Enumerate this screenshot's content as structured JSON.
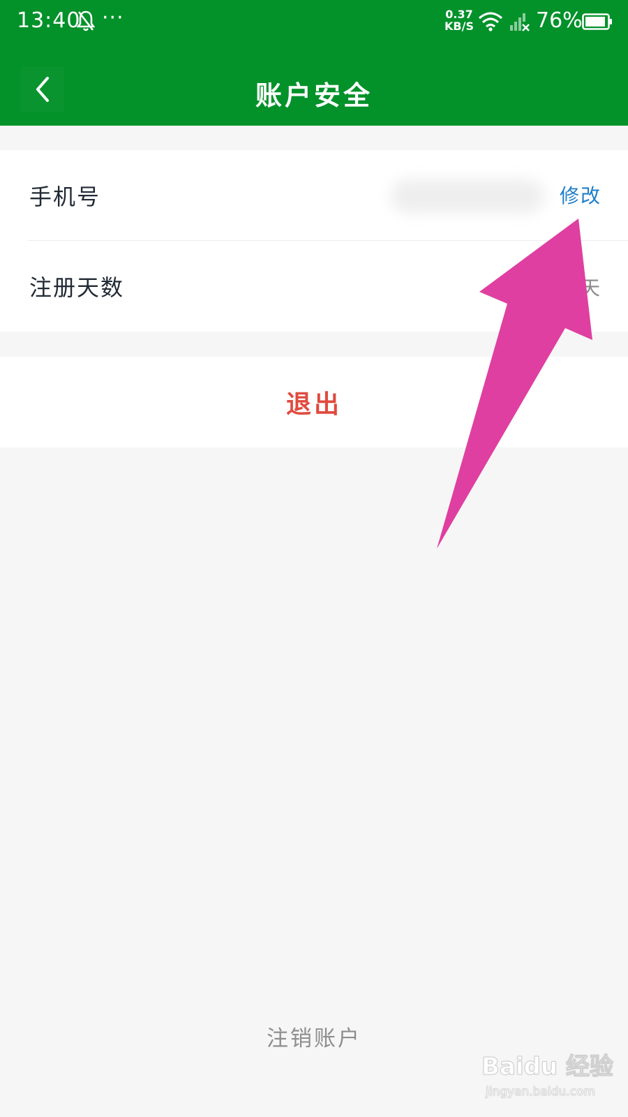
{
  "status_bar": {
    "time": "13:40",
    "more": "···",
    "net_speed_value": "0.37",
    "net_speed_unit": "KB/S",
    "battery": "76%"
  },
  "nav": {
    "title": "账户安全"
  },
  "account": {
    "phone_label": "手机号",
    "modify_label": "修改",
    "days_label": "注册天数",
    "days_value": "天"
  },
  "actions": {
    "logout_label": "退出",
    "cancel_account_label": "注销账户"
  },
  "watermark": {
    "logo": "Baidu 经验",
    "url": "jingyan.baidu.com"
  },
  "colors": {
    "header": "#03912a",
    "link": "#1f7ec9",
    "danger": "#e04a3f",
    "annotation_arrow": "#df3fa0"
  }
}
